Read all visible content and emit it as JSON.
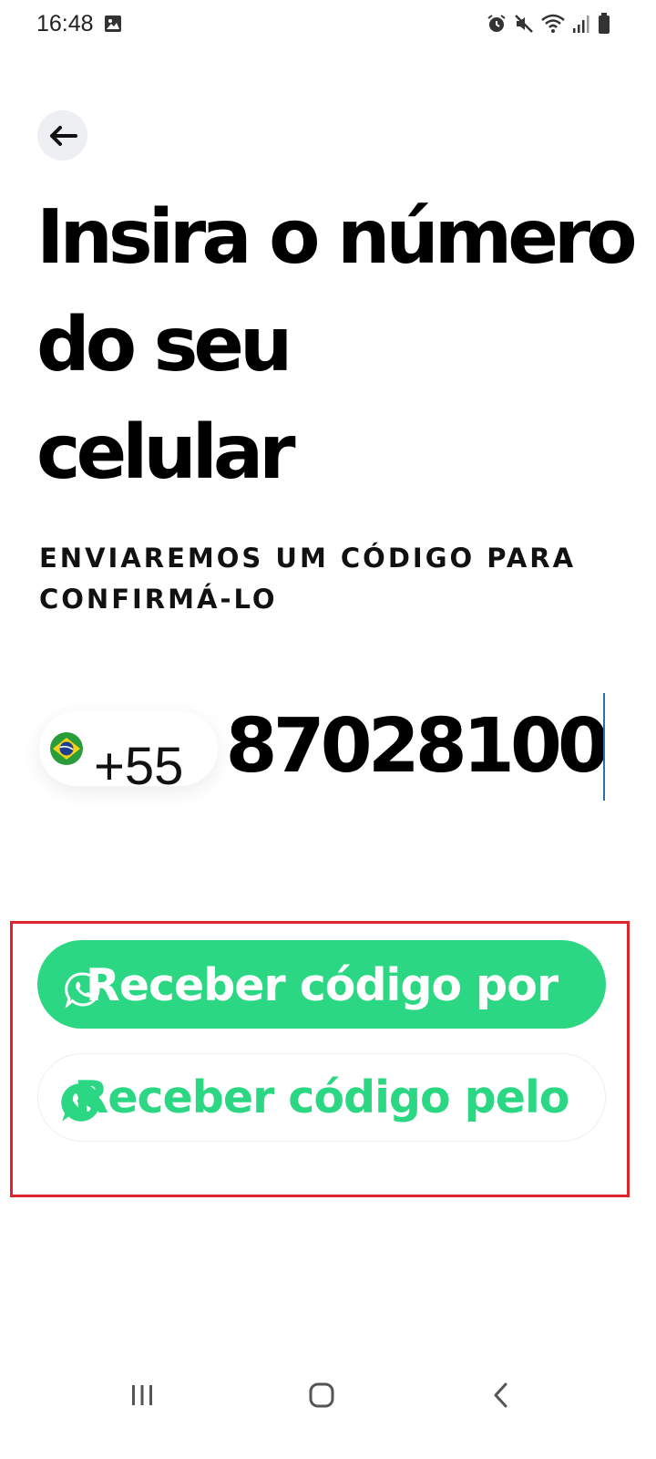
{
  "status_bar": {
    "time": "16:48",
    "left_icons": [
      "image-icon"
    ],
    "right_icons": [
      "alarm-icon",
      "mute-icon",
      "wifi-icon",
      "signal-icon",
      "battery-icon"
    ]
  },
  "back_button": {
    "icon": "arrow-left-icon"
  },
  "title_lines": [
    "Insira o número",
    "do seu",
    "celular"
  ],
  "subtitle_lines": [
    "ENVIAREMOS UM CÓDIGO PARA",
    "CONFIRMÁ-LO"
  ],
  "phone": {
    "country_flag": "brazil-flag-icon",
    "country_code": "+55",
    "value": "87028100"
  },
  "buttons": {
    "sms": {
      "label": "Receber código por SMS",
      "icon": "whatsapp-icon"
    },
    "whatsapp": {
      "label": "Receber código pelo WhatsApp",
      "icon": "whatsapp-icon"
    }
  },
  "nav_bar": {
    "icons": [
      "recents-icon",
      "home-icon",
      "back-icon"
    ]
  },
  "colors": {
    "accent_green": "#2cd783",
    "highlight_red": "#e0242c",
    "back_button_bg": "#eeeff3"
  }
}
